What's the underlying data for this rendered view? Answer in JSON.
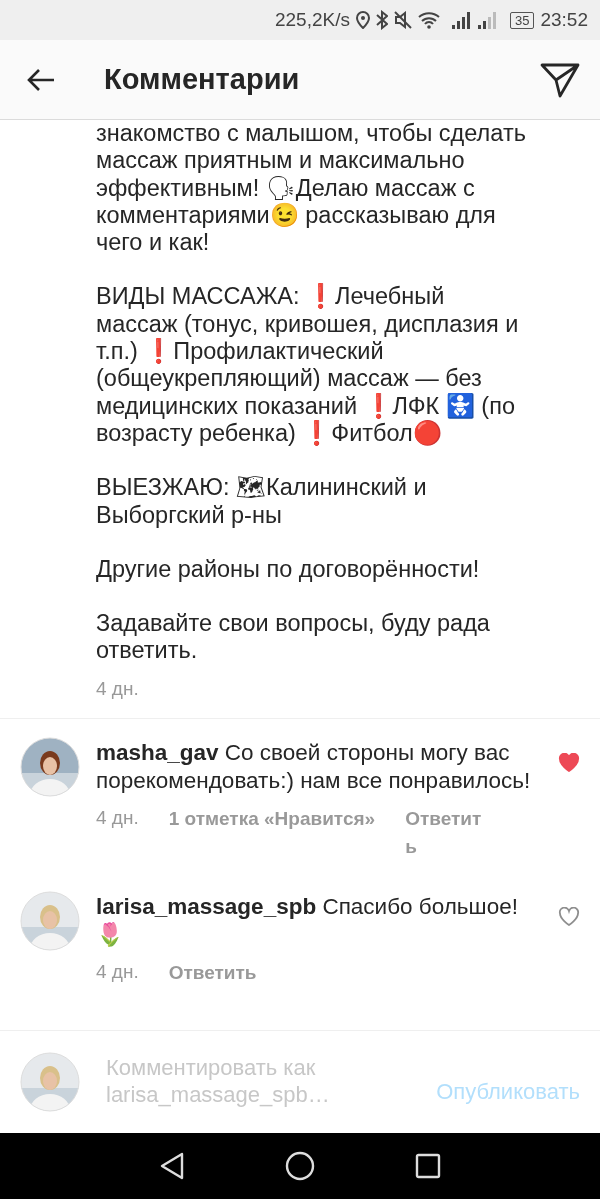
{
  "status_bar": {
    "speed": "225,2K/s",
    "battery": "35",
    "time": "23:52"
  },
  "header": {
    "title": "Комментарии"
  },
  "caption": {
    "paragraphs": [
      "знакомство с малышом, чтобы сделать массаж приятным и максимально эффективным! 🗣Делаю массаж с комментариями😉 рассказываю для чего и как!",
      "ВИДЫ МАССАЖА: ❗Лечебный массаж (тонус, кривошея, дисплазия и т.п.) ❗Профилактический (общеукрепляющий) массаж — без медицинских показаний ❗ЛФК 🚼 (по возрасту ребенка) ❗Фитбол🔴",
      "ВЫЕЗЖАЮ: 🗺Калининский и Выборгский р-ны",
      "Другие районы по договорённости!",
      "Задавайте свои вопросы, буду рада ответить."
    ],
    "time": "4 дн."
  },
  "comments": [
    {
      "username": "masha_gav",
      "text": "Со своей стороны могу вас порекомендовать:) нам все понравилось!",
      "time": "4 дн.",
      "likes": "1 отметка «Нравится»",
      "reply": "Ответить",
      "liked": true
    },
    {
      "username": "larisa_massage_spb",
      "text": "Спасибо большое! 🌷",
      "time": "4 дн.",
      "reply": "Ответить",
      "liked": false
    }
  ],
  "composer": {
    "placeholder": "Комментировать как larisa_massage_spb…",
    "button": "Опубликовать"
  }
}
